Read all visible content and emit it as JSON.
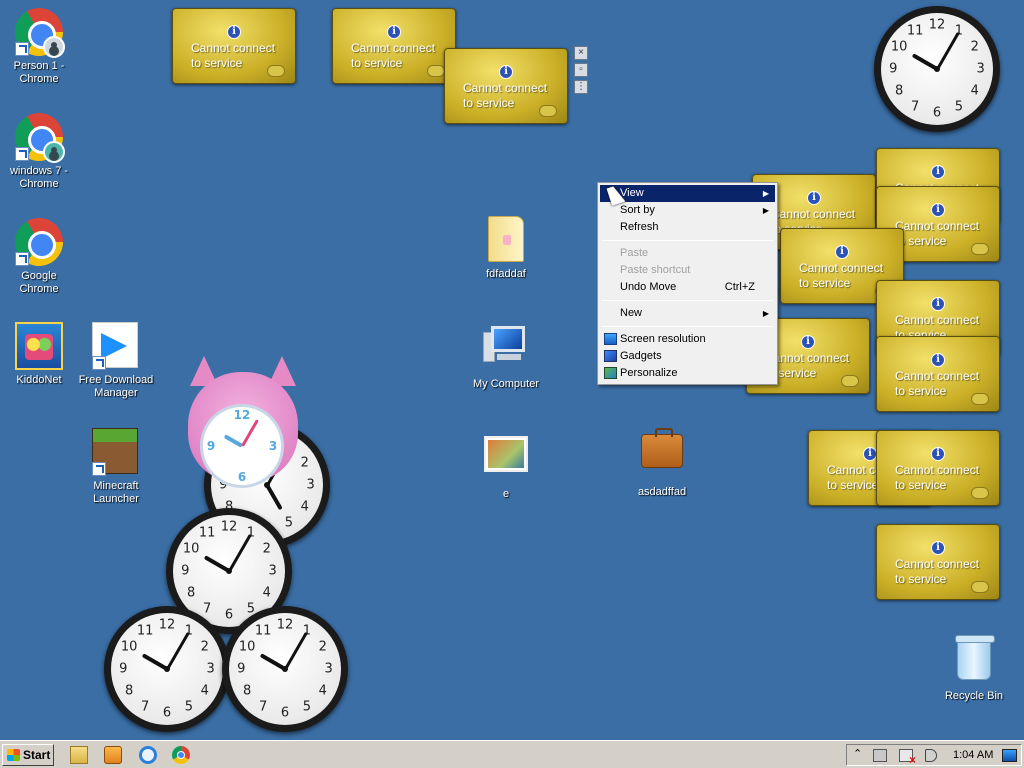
{
  "desktop_icons": {
    "person1_chrome": "Person 1 - Chrome",
    "windows7_chrome": "windows 7 - Chrome",
    "google_chrome": "Google Chrome",
    "kiddonet": "KiddoNet",
    "free_download_manager": "Free Download Manager",
    "minecraft_launcher": "Minecraft Launcher",
    "fdfaddaf": "fdfaddaf",
    "my_computer": "My Computer",
    "e": "e",
    "asdadffad": "asdadffad",
    "recycle_bin": "Recycle Bin"
  },
  "gadget": {
    "line1": "Cannot connect",
    "line2": "to service",
    "info_symbol": "i"
  },
  "clock_numbers": [
    "12",
    "1",
    "2",
    "3",
    "4",
    "5",
    "6",
    "7",
    "8",
    "9",
    "10",
    "11"
  ],
  "context_menu": {
    "view": "View",
    "sort_by": "Sort by",
    "refresh": "Refresh",
    "paste": "Paste",
    "paste_shortcut": "Paste shortcut",
    "undo_move": "Undo Move",
    "undo_shortcut": "Ctrl+Z",
    "new": "New",
    "screen_resolution": "Screen resolution",
    "gadgets": "Gadgets",
    "personalize": "Personalize",
    "submenu_arrow": "▶"
  },
  "taskbar": {
    "start_label": "Start",
    "clock": "1:04 AM",
    "tray_chevron": "⌃"
  },
  "colors": {
    "desktop": "#3a6ea5",
    "menu_highlight": "#0a246a",
    "gadget_gold": "#cbb027"
  }
}
